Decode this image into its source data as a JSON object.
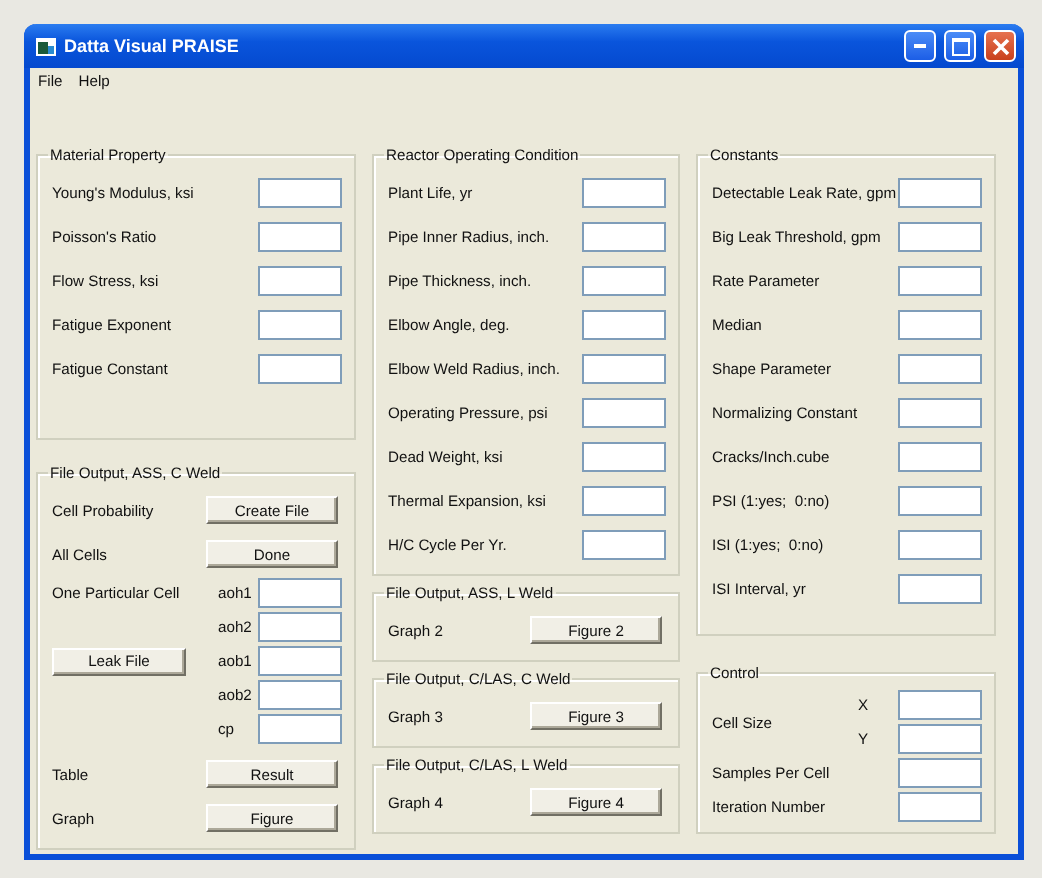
{
  "window": {
    "title": "Datta Visual PRAISE"
  },
  "menu": [
    "File",
    "Help"
  ],
  "columns": [
    [
      {
        "title": "Material Property",
        "rows": [
          {
            "kind": "field",
            "label": "Young's Modulus, ksi"
          },
          {
            "kind": "field",
            "label": "Poisson's Ratio"
          },
          {
            "kind": "field",
            "label": "Flow Stress, ksi"
          },
          {
            "kind": "field",
            "label": "Fatigue Exponent"
          },
          {
            "kind": "field",
            "label": "Fatigue Constant"
          }
        ]
      },
      {
        "title": "File Output, ASS, C Weld",
        "rows": [
          {
            "kind": "button",
            "label": "Cell Probability",
            "button": "Create File"
          },
          {
            "kind": "button",
            "label": "All Cells",
            "button": "Done"
          },
          {
            "kind": "cell",
            "label": "One Particular Cell",
            "button": "Leak File",
            "fields": [
              "aoh1",
              "aoh2",
              "aob1",
              "aob2",
              "cp"
            ]
          },
          {
            "kind": "button",
            "label": "Table",
            "button": "Result"
          },
          {
            "kind": "button",
            "label": "Graph",
            "button": "Figure"
          }
        ]
      }
    ],
    [
      {
        "title": "Reactor Operating Condition",
        "rows": [
          {
            "kind": "field",
            "label": "Plant Life, yr"
          },
          {
            "kind": "field",
            "label": "Pipe Inner Radius, inch."
          },
          {
            "kind": "field",
            "label": "Pipe Thickness, inch."
          },
          {
            "kind": "field",
            "label": "Elbow Angle, deg."
          },
          {
            "kind": "field",
            "label": "Elbow Weld Radius, inch."
          },
          {
            "kind": "field",
            "label": "Operating Pressure, psi"
          },
          {
            "kind": "field",
            "label": "Dead Weight, ksi"
          },
          {
            "kind": "field",
            "label": "Thermal Expansion, ksi"
          },
          {
            "kind": "field",
            "label": "H/C Cycle Per Yr."
          }
        ]
      },
      {
        "title": "File Output, ASS, L Weld",
        "rows": [
          {
            "kind": "button",
            "label": "Graph 2",
            "button": "Figure 2"
          }
        ]
      },
      {
        "title": "File Output, C/LAS, C Weld",
        "rows": [
          {
            "kind": "button",
            "label": "Graph 3",
            "button": "Figure 3"
          }
        ]
      },
      {
        "title": "File Output, C/LAS, L Weld",
        "rows": [
          {
            "kind": "button",
            "label": "Graph 4",
            "button": "Figure 4"
          }
        ]
      }
    ],
    [
      {
        "title": "Constants",
        "rows": [
          {
            "kind": "field",
            "label": "Detectable Leak Rate, gpm"
          },
          {
            "kind": "field",
            "label": "Big Leak Threshold, gpm"
          },
          {
            "kind": "field",
            "label": "Rate Parameter"
          },
          {
            "kind": "field",
            "label": "Median"
          },
          {
            "kind": "field",
            "label": "Shape Parameter"
          },
          {
            "kind": "field",
            "label": "Normalizing Constant"
          },
          {
            "kind": "field",
            "label": "Cracks/Inch.cube"
          },
          {
            "kind": "field",
            "label": "PSI (1:yes;  0:no)"
          },
          {
            "kind": "field",
            "label": "ISI (1:yes;  0:no)"
          },
          {
            "kind": "field",
            "label": "ISI Interval, yr"
          }
        ]
      },
      {
        "title": "Control",
        "rows": [
          {
            "kind": "pair",
            "label": "Cell Size",
            "sublabels": [
              "X",
              "Y"
            ]
          },
          {
            "kind": "small",
            "label": "Samples Per Cell"
          },
          {
            "kind": "small",
            "label": "Iteration Number"
          }
        ]
      }
    ]
  ]
}
